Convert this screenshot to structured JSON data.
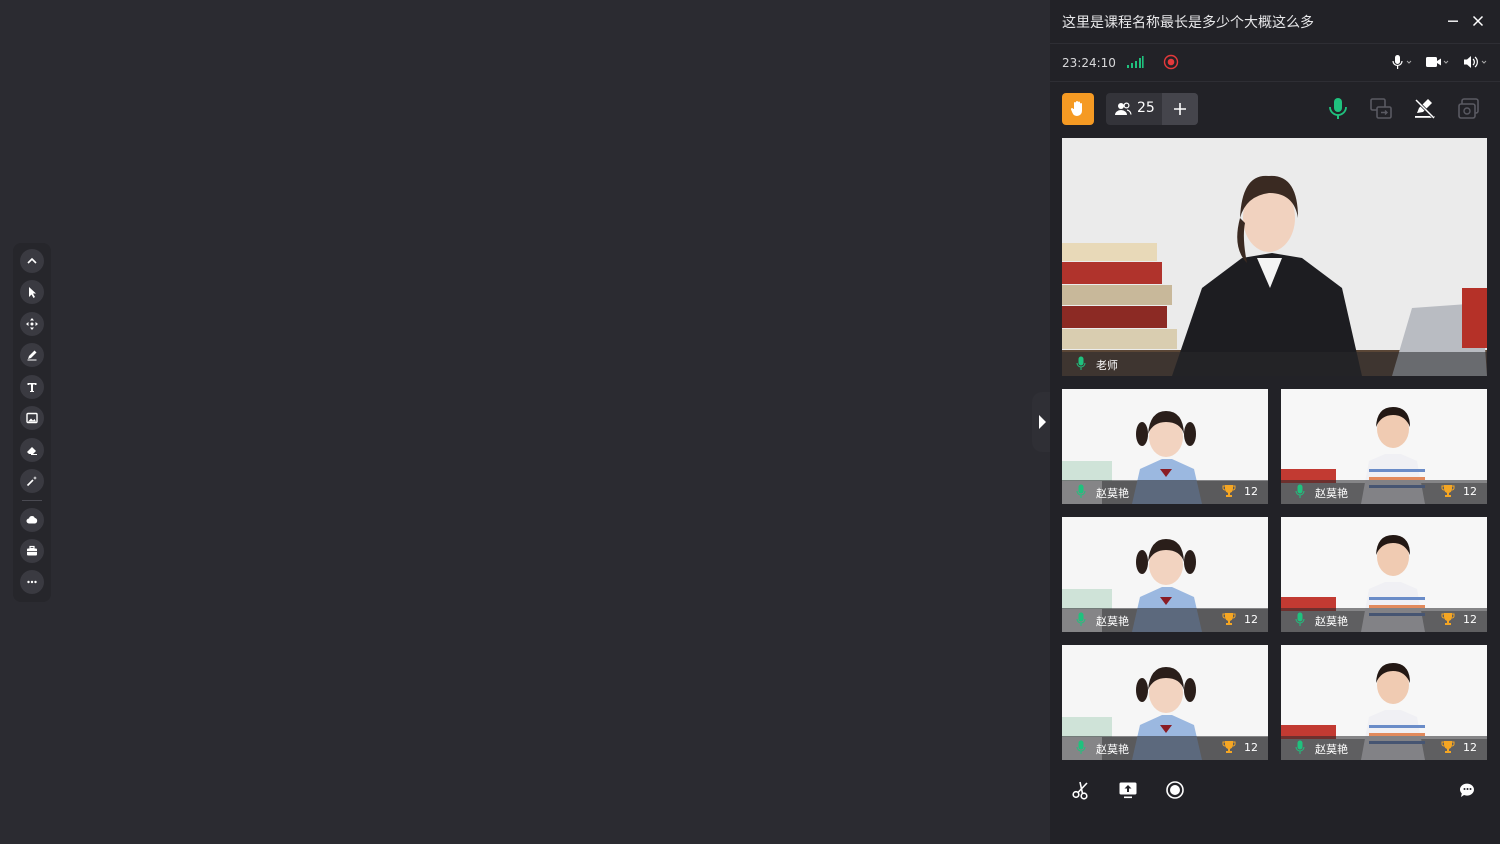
{
  "course_title": "这里是课程名称最长是多少个大概这么多",
  "status": {
    "time": "23:24:10"
  },
  "participants": {
    "count": "25"
  },
  "teacher": {
    "name": "老师"
  },
  "students": [
    {
      "name": "赵莫艳",
      "score": "12"
    },
    {
      "name": "赵莫艳",
      "score": "12"
    },
    {
      "name": "赵莫艳",
      "score": "12"
    },
    {
      "name": "赵莫艳",
      "score": "12"
    },
    {
      "name": "赵莫艳",
      "score": "12"
    },
    {
      "name": "赵莫艳",
      "score": "12"
    }
  ],
  "colors": {
    "background": "#2b2b31",
    "panel": "#222227",
    "accent_orange": "#f59a23",
    "accent_green": "#1fc27e",
    "record_red": "#e5393b"
  },
  "icons": {
    "toolbar": [
      "collapse-up-icon",
      "pointer-icon",
      "move-icon",
      "pen-icon",
      "text-icon",
      "image-icon",
      "eraser-icon",
      "laser-icon",
      "cloud-icon",
      "toolbox-icon",
      "more-icon"
    ],
    "header": [
      "minimize-icon",
      "close-icon"
    ],
    "status": [
      "signal-icon",
      "record-icon",
      "microphone-icon",
      "camera-icon",
      "speaker-icon"
    ],
    "controls": [
      "raise-hand-icon",
      "people-icon",
      "add-icon",
      "mic-all-icon",
      "switch-camera-icon",
      "clear-board-icon",
      "screen-share-icon"
    ],
    "bottom": [
      "scissors-icon",
      "upload-icon",
      "record-circle-icon",
      "chat-icon"
    ]
  }
}
